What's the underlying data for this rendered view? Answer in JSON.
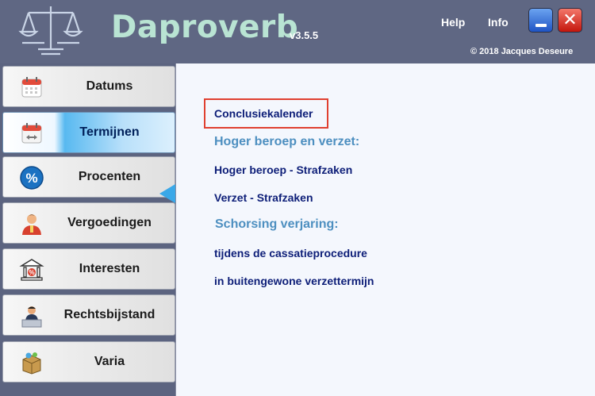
{
  "app": {
    "title": "Daproverb",
    "version": "v3.5.5",
    "copyright": "© 2018 Jacques Deseure"
  },
  "header": {
    "help_label": "Help",
    "info_label": "Info",
    "minimize_icon": "minimize-icon",
    "close_icon": "close-icon",
    "close_glyph": "✕",
    "logo_icon": "scales-of-justice-icon"
  },
  "sidebar": {
    "active_index": 1,
    "items": [
      {
        "label": "Datums",
        "icon": "calendar-icon"
      },
      {
        "label": "Termijnen",
        "icon": "calendar-arrows-icon"
      },
      {
        "label": "Procenten",
        "icon": "percent-icon"
      },
      {
        "label": "Vergoedingen",
        "icon": "person-icon"
      },
      {
        "label": "Interesten",
        "icon": "bank-icon"
      },
      {
        "label": "Rechtsbijstand",
        "icon": "lawyer-desk-icon"
      },
      {
        "label": "Varia",
        "icon": "box-icon"
      }
    ]
  },
  "content": {
    "conclusiekalender": "Conclusiekalender",
    "section_hoger_beroep": "Hoger beroep en verzet:",
    "hoger_beroep_strafzaken": "Hoger beroep - Strafzaken",
    "verzet_strafzaken": "Verzet - Strafzaken",
    "section_schorsing": "Schorsing verjaring:",
    "cassatie": "tijdens de cassatieprocedure",
    "verzettermijn": "in buitengewone verzettermijn"
  },
  "colors": {
    "header_bg": "#5f6783",
    "title_color": "#b9e4d3",
    "link_color": "#0d1e78",
    "section_color": "#4d8fc0",
    "active_accent": "#3aa8e8",
    "focus_outline": "#e04030"
  }
}
